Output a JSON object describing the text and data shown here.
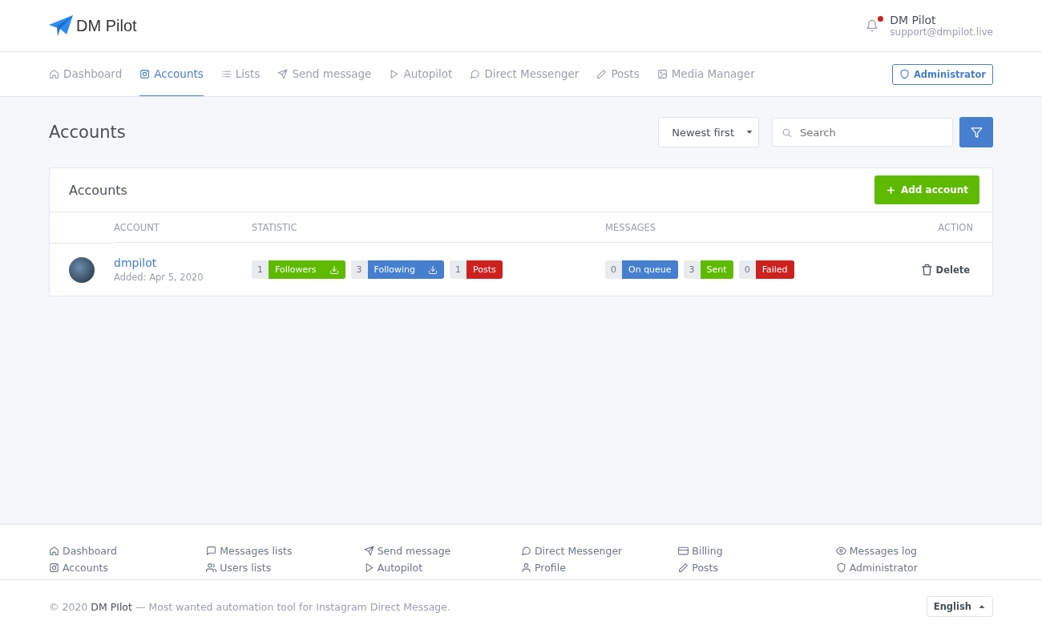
{
  "brand": {
    "name": "DM Pilot"
  },
  "user": {
    "name": "DM Pilot",
    "email": "support@dmpilot.live",
    "has_notifications": true
  },
  "nav": {
    "items": [
      {
        "label": "Dashboard",
        "selected": false
      },
      {
        "label": "Accounts",
        "selected": true
      },
      {
        "label": "Lists",
        "selected": false
      },
      {
        "label": "Send message",
        "selected": false
      },
      {
        "label": "Autopilot",
        "selected": false
      },
      {
        "label": "Direct Messenger",
        "selected": false
      },
      {
        "label": "Posts",
        "selected": false
      },
      {
        "label": "Media Manager",
        "selected": false
      }
    ],
    "admin_button": "Administrator"
  },
  "page": {
    "title": "Accounts",
    "sort": "Newest first",
    "search": {
      "placeholder": "Search"
    }
  },
  "card": {
    "title": "Accounts",
    "add_button": "Add account",
    "columns": [
      "ACCOUNT",
      "STATISTIC",
      "MESSAGES",
      "ACTION"
    ],
    "rows": [
      {
        "username": "dmpilot",
        "added": "Added: Apr 5, 2020",
        "statistic": [
          {
            "count": "1",
            "label": "Followers",
            "color": "#5eba00",
            "download": true
          },
          {
            "count": "3",
            "label": "Following",
            "color": "#467fcf",
            "download": true
          },
          {
            "count": "1",
            "label": "Posts",
            "color": "#cd201f",
            "download": false
          }
        ],
        "messages": [
          {
            "count": "0",
            "label": "On queue",
            "color": "#467fcf"
          },
          {
            "count": "3",
            "label": "Sent",
            "color": "#5eba00"
          },
          {
            "count": "0",
            "label": "Failed",
            "color": "#cd201f"
          }
        ],
        "action": "Delete"
      }
    ]
  },
  "footer": {
    "columns": [
      [
        "Dashboard",
        "Accounts"
      ],
      [
        "Messages lists",
        "Users lists"
      ],
      [
        "Send message",
        "Autopilot"
      ],
      [
        "Direct Messenger",
        "Profile"
      ],
      [
        "Billing",
        "Posts"
      ],
      [
        "Messages log",
        "Administrator"
      ]
    ],
    "copyright": "© 2020",
    "brand": "DM PIlot",
    "tagline": "— Most wanted automation tool for Instagram Direct Message.",
    "language": "English"
  }
}
